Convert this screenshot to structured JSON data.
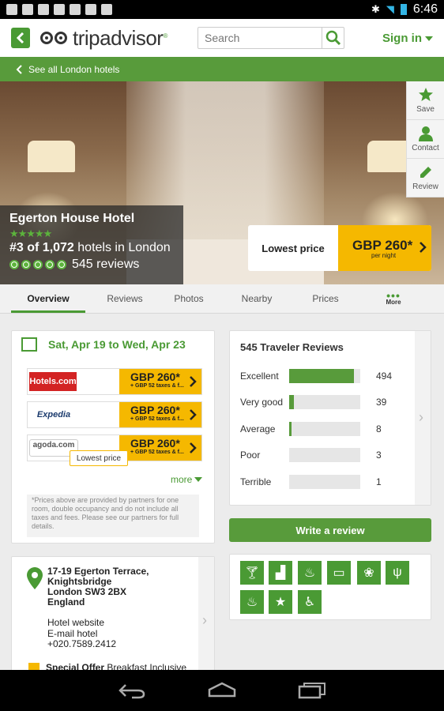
{
  "statusbar": {
    "time": "6:46"
  },
  "header": {
    "brand": "tripadvisor",
    "search_placeholder": "Search",
    "signin": "Sign in"
  },
  "subnav": {
    "back_link": "See all London hotels"
  },
  "hotel": {
    "name": "Egerton House Hotel",
    "rank_prefix": "#3 of 1,072",
    "rank_suffix": " hotels in London",
    "reviews_count": "545 reviews",
    "lowest_price_label": "Lowest price",
    "price": "GBP 260*",
    "per_night": "per night"
  },
  "side_actions": [
    {
      "label": "Save",
      "icon": "star-icon"
    },
    {
      "label": "Contact",
      "icon": "person-icon"
    },
    {
      "label": "Review",
      "icon": "pencil-icon"
    }
  ],
  "tabs": [
    "Overview",
    "Reviews",
    "Photos",
    "Nearby",
    "Prices",
    "More"
  ],
  "booking": {
    "dates": "Sat, Apr 19 to Wed, Apr 23",
    "partners": [
      {
        "name": "Hotels.com",
        "price": "GBP 260*",
        "taxes": "+ GBP 52 taxes & f..."
      },
      {
        "name": "Expedia",
        "price": "GBP 260*",
        "taxes": "+ GBP 52 taxes & f..."
      },
      {
        "name": "agoda.com",
        "price": "GBP 260*",
        "taxes": "+ GBP 52 taxes & f..."
      }
    ],
    "tooltip": "Lowest price",
    "more": "more",
    "disclaimer": "*Prices above are provided by partners for one room, double occupancy and do not include all taxes and fees. Please see our partners for full details."
  },
  "reviews": {
    "title": "545 Traveler Reviews",
    "rows": [
      {
        "label": "Excellent",
        "count": "494",
        "fraction": 0.906
      },
      {
        "label": "Very good",
        "count": "39",
        "fraction": 0.072
      },
      {
        "label": "Average",
        "count": "8",
        "fraction": 0.015
      },
      {
        "label": "Poor",
        "count": "3",
        "fraction": 0.0
      },
      {
        "label": "Terrible",
        "count": "1",
        "fraction": 0.0
      }
    ],
    "write_button": "Write a review"
  },
  "address": {
    "line1": "17-19 Egerton Terrace,",
    "line2": "Knightsbridge",
    "line3": "London SW3 2BX",
    "line4": "England",
    "website": "Hotel website",
    "email": "E-mail hotel",
    "phone": "+020.7589.2412",
    "offer_label": "Special Offer",
    "offer_text": " Breakfast Inclusive"
  },
  "amenities": [
    "bar-icon",
    "room-service-icon",
    "restaurant-chef-icon",
    "computer-icon",
    "pets-icon",
    "dining-icon",
    "spa-icon",
    "star-icon",
    "wheelchair-icon"
  ],
  "colors": {
    "brand_green": "#589b3b",
    "price_yellow": "#f5b800"
  }
}
